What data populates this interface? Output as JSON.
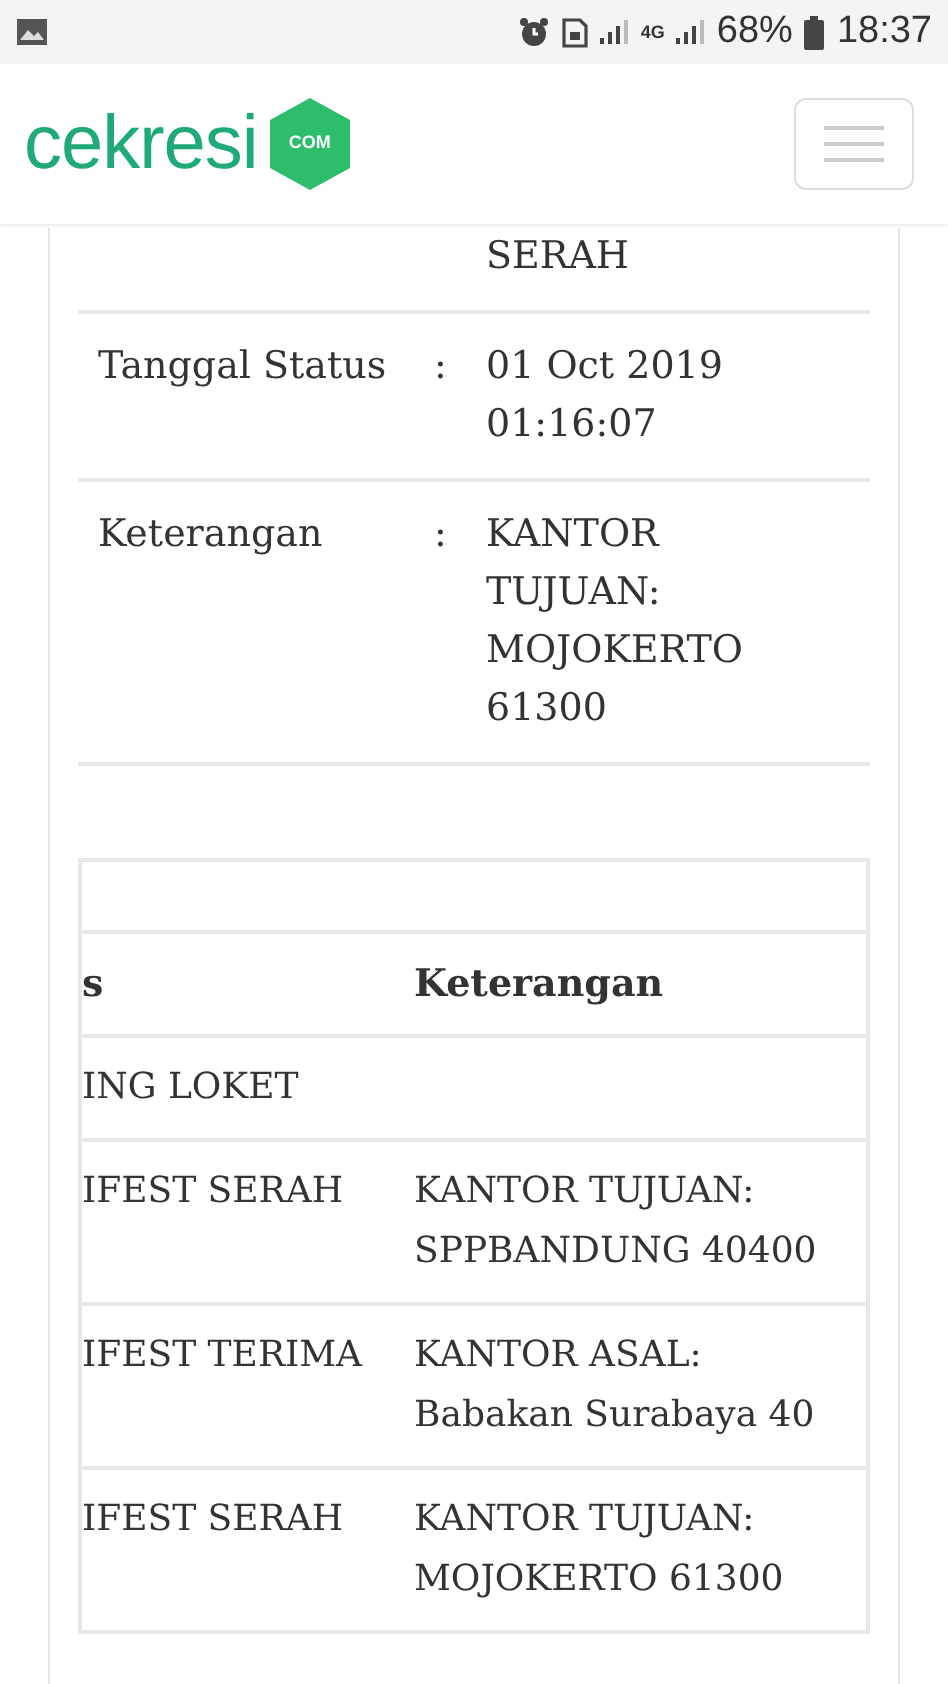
{
  "status_bar": {
    "network": "4G",
    "battery": "68%",
    "time": "18:37"
  },
  "header": {
    "logo_text": "cekresi",
    "logo_badge": "COM"
  },
  "detail_rows": [
    {
      "label": "",
      "separator": "",
      "value": "SERAH"
    },
    {
      "label": "Tanggal Status",
      "separator": ":",
      "value": "01 Oct 2019 01:16:07"
    },
    {
      "label": "Keterangan",
      "separator": ":",
      "value": "KANTOR TUJUAN: MOJOKERTO 61300"
    }
  ],
  "history_table": {
    "columns": [
      "s",
      "Keterangan"
    ],
    "rows": [
      [
        "ING LOKET",
        ""
      ],
      [
        "IFEST SERAH",
        "KANTOR TUJUAN: SPPBANDUNG 40400"
      ],
      [
        "IFEST TERIMA",
        "KANTOR ASAL: Babakan Surabaya 40"
      ],
      [
        "IFEST SERAH",
        "KANTOR TUJUAN: MOJOKERTO 61300"
      ]
    ]
  }
}
